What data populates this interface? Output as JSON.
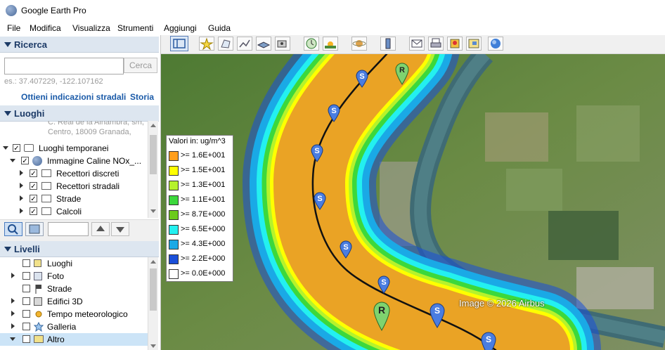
{
  "window": {
    "title": "Google Earth Pro"
  },
  "menu": {
    "items": [
      "File",
      "Modifica",
      "Visualizza",
      "Strumenti",
      "Aggiungi",
      "Guida"
    ]
  },
  "search": {
    "header": "Ricerca",
    "placeholder": "",
    "button": "Cerca",
    "hint": "es.: 37.407229, -122.107162",
    "directions_link": "Ottieni indicazioni stradali",
    "history_link": "Storia"
  },
  "places": {
    "header": "Luoghi",
    "address_line1": "C. Real de la Alhambra, s/n,",
    "address_line2": "Centro, 18009 Granada,",
    "items": [
      {
        "label": "Luoghi temporanei",
        "checked": true
      },
      {
        "label": "Immagine Caline NOx_...",
        "checked": true
      },
      {
        "label": "Recettori discreti",
        "checked": true
      },
      {
        "label": "Recettori stradali",
        "checked": true
      },
      {
        "label": "Strade",
        "checked": true
      },
      {
        "label": "Calcoli",
        "checked": true
      }
    ]
  },
  "layers": {
    "header": "Livelli",
    "items": [
      {
        "label": "Luoghi",
        "checked": false
      },
      {
        "label": "Foto",
        "checked": false
      },
      {
        "label": "Strade",
        "checked": false
      },
      {
        "label": "Edifici 3D",
        "checked": false
      },
      {
        "label": "Tempo meteorologico",
        "checked": false
      },
      {
        "label": "Galleria",
        "checked": false
      },
      {
        "label": "Altro",
        "checked": false
      }
    ]
  },
  "legend": {
    "title": "Valori in: ug/m^3",
    "entries": [
      {
        "label": ">= 1.6E+001",
        "color": "#ff9e1b"
      },
      {
        "label": ">= 1.5E+001",
        "color": "#ffff00"
      },
      {
        "label": ">= 1.3E+001",
        "color": "#b6f22c"
      },
      {
        "label": ">= 1.1E+001",
        "color": "#3cd83c"
      },
      {
        "label": ">= 8.7E+000",
        "color": "#6cca1c"
      },
      {
        "label": ">= 6.5E+000",
        "color": "#23f0f0"
      },
      {
        "label": ">= 4.3E+000",
        "color": "#1aa9e6"
      },
      {
        "label": ">= 2.2E+000",
        "color": "#1a4fd9"
      },
      {
        "label": ">= 0.0E+000",
        "color": "#ffffff"
      }
    ]
  },
  "map": {
    "credit": "Image © 2026 Airbus"
  },
  "markers": {
    "discrete_letter": "R",
    "road_letter": "S"
  },
  "toolbar": {
    "icons": [
      "sidebar-toggle-icon",
      "placemark-icon",
      "polygon-icon",
      "path-icon",
      "overlay-icon",
      "tour-icon",
      "history-icon",
      "sunlight-icon",
      "planets-icon",
      "ruler-icon",
      "email-icon",
      "print-icon",
      "save-image-icon",
      "map-icon",
      "maps-icon"
    ]
  }
}
